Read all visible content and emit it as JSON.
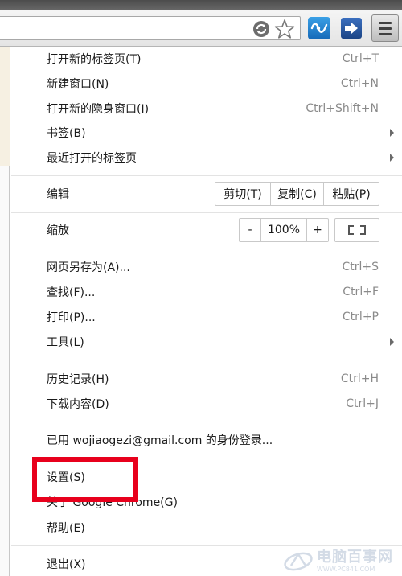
{
  "icons": {
    "sync": "sync-icon",
    "star": "star-icon",
    "extension_1": "extension-icon",
    "extension_2": "extension-icon",
    "menu": "hamburger-menu-icon"
  },
  "menu": {
    "new_tab": {
      "label": "打开新的标签页(T)",
      "shortcut": "Ctrl+T"
    },
    "new_window": {
      "label": "新建窗口(N)",
      "shortcut": "Ctrl+N"
    },
    "new_incognito": {
      "label": "打开新的隐身窗口(I)",
      "shortcut": "Ctrl+Shift+N"
    },
    "bookmarks": {
      "label": "书签(B)"
    },
    "recent_tabs": {
      "label": "最近打开的标签页"
    },
    "edit": {
      "label": "编辑",
      "cut": "剪切(T)",
      "copy": "复制(C)",
      "paste": "粘贴(P)"
    },
    "zoom": {
      "label": "缩放",
      "minus": "-",
      "value": "100%",
      "plus": "+"
    },
    "save_as": {
      "label": "网页另存为(A)...",
      "shortcut": "Ctrl+S"
    },
    "find": {
      "label": "查找(F)...",
      "shortcut": "Ctrl+F"
    },
    "print": {
      "label": "打印(P)...",
      "shortcut": "Ctrl+P"
    },
    "tools": {
      "label": "工具(L)"
    },
    "history": {
      "label": "历史记录(H)",
      "shortcut": "Ctrl+H"
    },
    "downloads": {
      "label": "下载内容(D)",
      "shortcut": "Ctrl+J"
    },
    "signed_in": {
      "label": "已用 wojiaogezi@gmail.com 的身份登录..."
    },
    "settings": {
      "label": "设置(S)"
    },
    "about": {
      "label": "关于 Google Chrome(G)"
    },
    "help": {
      "label": "帮助(E)"
    },
    "exit": {
      "label": "退出(X)"
    }
  },
  "watermark": {
    "name": "电脑百事网",
    "url": "WWW.PC841.COM"
  },
  "colors": {
    "highlight": "#e8001c",
    "shortcut_text": "#8a8a8a",
    "separator": "#e3e3e3"
  }
}
